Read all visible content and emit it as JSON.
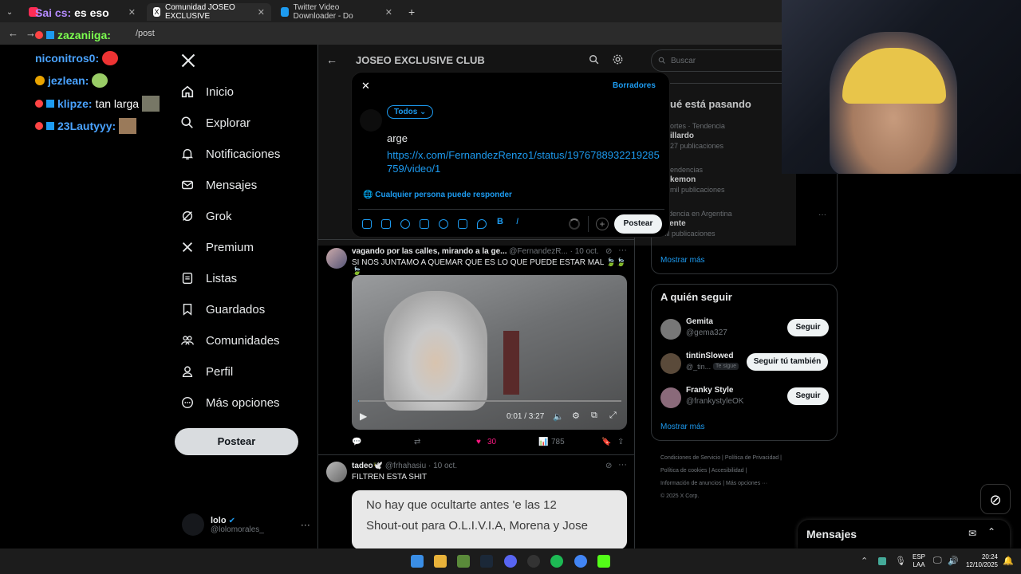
{
  "browser": {
    "tabs": [
      {
        "label": "Sai cs: es eso"
      },
      {
        "label": "Comunidad JOSEO EXCLUSIVE"
      },
      {
        "label": "Twitter Video Downloader - Do"
      }
    ],
    "url_fragment": "/post",
    "new_tab": "+"
  },
  "chat": [
    {
      "user": "Sai cs:",
      "text": "es eso"
    },
    {
      "user": "zazaniiga:",
      "text": ""
    },
    {
      "user": "niconitros0:",
      "text": ""
    },
    {
      "user": "jezlean:",
      "text": ""
    },
    {
      "user": "klipze:",
      "text": "tan larga"
    },
    {
      "user": "23Lautyyy:",
      "text": ""
    }
  ],
  "nav": {
    "items": [
      "Inicio",
      "Explorar",
      "Notificaciones",
      "Mensajes",
      "Grok",
      "Premium",
      "Listas",
      "Guardados",
      "Comunidades",
      "Perfil",
      "Más opciones"
    ],
    "post_button": "Postear",
    "profile_name": "lolo",
    "profile_handle": "@lolomorales_",
    "more": "···"
  },
  "community": {
    "title": "JOSEO EXCLUSIVE CLUB"
  },
  "composer": {
    "drafts": "Borradores",
    "audience": "Todos",
    "text": "arge",
    "link": "https://x.com/FernandezRenzo1/status/1976788932219285759/video/1",
    "reply_setting": "Cualquier persona puede responder",
    "post_button": "Postear"
  },
  "tweets": [
    {
      "name": "vagando por las calles, mirando a la ge...",
      "handle": "@FernandezR...",
      "date": "· 10 oct.",
      "text": "SI NOS JUNTAMO A QUEMAR QUE ES LO QUE PUEDE ESTAR MAL 🍃🍃🍃",
      "video_time": "0:01 / 3:27",
      "likes": "30",
      "views": "785"
    },
    {
      "name": "tadeo🕊️",
      "handle": "@frhahasiu",
      "date": "· 10 oct.",
      "text": "FILTREN ESTA SHIT",
      "image_text_1": "No hay que ocultarte antes 'e las 12",
      "image_text_2": "Shout-out para O.L.I.V.I.A, Morena y Jose"
    }
  ],
  "right": {
    "search_placeholder": "Buscar",
    "trends_title": "ué está pasando",
    "trends": [
      {
        "context": "ortes · Tendencia",
        "name": "illardo",
        "count": "27 publicaciones"
      },
      {
        "context": "endencias",
        "name": "kemon",
        "count": "mil publicaciones"
      },
      {
        "context": "endencia en Argentina",
        "name": "acente",
        "count": "mil publicaciones"
      }
    ],
    "show_more": "Mostrar más",
    "follow_title": "A quién seguir",
    "follow": [
      {
        "name": "Gemita",
        "handle": "@gema327",
        "button": "Seguir",
        "badge": ""
      },
      {
        "name": "tintinSlowed",
        "handle": "@_tin...",
        "button": "Seguir tú también",
        "badge": "Te sigue"
      },
      {
        "name": "Franky Style",
        "handle": "@frankystyleOK",
        "button": "Seguir",
        "badge": ""
      }
    ],
    "show_more_2": "Mostrar más",
    "footer": [
      "Condiciones de Servicio",
      "Política de Privacidad",
      "Política de cookies",
      "Accesibilidad",
      "Información de anuncios",
      "Más opciones ···",
      "© 2025 X Corp."
    ]
  },
  "messages": {
    "title": "Mensajes"
  },
  "taskbar": {
    "lang": "ESP",
    "layout": "LAA",
    "time": "20:24",
    "date": "12/10/2025"
  },
  "colors": {
    "accent": "#1d9bf0",
    "like": "#f91880",
    "background": "#000000"
  }
}
